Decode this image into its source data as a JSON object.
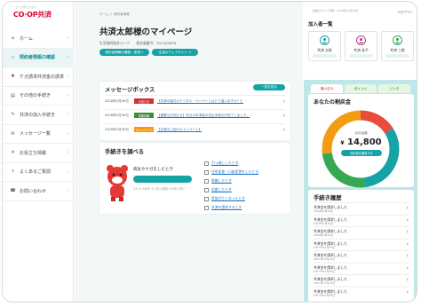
{
  "brand": {
    "logo_text": "CO·OP共済",
    "logo_sub": "コープきょうさい"
  },
  "nav": {
    "items": [
      {
        "label": "ホーム",
        "icon": "home-icon",
        "active": false
      },
      {
        "label": "契約者情報の確認",
        "icon": "id-card-icon",
        "active": true
      },
      {
        "label": "ケガ請求共済金の請求",
        "icon": "bandage-icon",
        "active": false
      },
      {
        "label": "その他の手続き",
        "icon": "document-icon",
        "active": false
      },
      {
        "label": "共済の加入手続き",
        "icon": "pen-icon",
        "active": false
      },
      {
        "label": "メッセージ一覧",
        "icon": "mail-icon",
        "active": false
      },
      {
        "label": "お役立ち情報",
        "icon": "lightbulb-icon",
        "active": false
      },
      {
        "label": "よくあるご質問",
        "icon": "question-icon",
        "active": false
      },
      {
        "label": "お問い合わせ",
        "icon": "phone-icon",
        "active": false
      }
    ]
  },
  "header": {
    "breadcrumb": "ホーム ＞ 契約者情報",
    "title": "共済太郎様のマイページ",
    "subline": "生活協同組合コープ　　組合員番号：912345678",
    "btn_contract": "契約者情報の確認・変更へ",
    "btn_web": "生協のウェブサイト ↗"
  },
  "messages": {
    "title": "メッセージボックス",
    "list_all": "一覧を見る",
    "rows": [
      {
        "date": "2018年1月30日",
        "badge": "お知らせ",
        "badge_color": "#d32f2f",
        "text": "【共済の給付のデジタル・ペーパーとはどう違いますか？】"
      },
      {
        "date": "2018年1月30日",
        "badge": "重要情報",
        "badge_color": "#3a8f3a",
        "text": "【重要なお知らせ】本日の共済金の支払手続きが完了しました。"
      },
      {
        "date": "2018年1月30日",
        "badge": "キャンペーン",
        "badge_color": "#f39c12",
        "text": "【共済のご紹介キャンペーン】"
      }
    ]
  },
  "procedures": {
    "title": "手続きを調べる",
    "question": "病気やケガをしたとき",
    "tags": "#ケガ #病気 #入院 #通院 #手術 #死亡",
    "links": [
      "引っ越ししたとき",
      "住所変更・口座変更をしたとき",
      "結婚したとき",
      "出産したとき",
      "家族が亡くなったとき",
      "共済を請求するとき"
    ]
  },
  "right": {
    "top_small": "最終ログイン日時：2018年01月30日",
    "logout": "ログアウト",
    "members_title": "加入者一覧",
    "members": [
      {
        "name": "共済 太郎",
        "color": "#16a3a5"
      },
      {
        "name": "共済 花子",
        "color": "#c23d8c"
      },
      {
        "name": "共済 三郎",
        "color": "#36a852"
      }
    ],
    "tabs": [
      "あいさつ",
      "ポイント",
      "リンク"
    ]
  },
  "points": {
    "title": "あなたの割戻金",
    "label": "合計金額",
    "currency": "¥",
    "value": "14,800",
    "button": "割戻金を確認する",
    "segments": [
      {
        "fraction": 0.16,
        "color": "#e74c3c"
      },
      {
        "fraction": 0.32,
        "color": "#16a3a5"
      },
      {
        "fraction": 0.25,
        "color": "#36a852"
      },
      {
        "fraction": 0.27,
        "color": "#f39c12"
      }
    ]
  },
  "history": {
    "title": "手続き履歴",
    "rows": [
      {
        "text": "共済金を請求しました",
        "date": "2018年1月28日"
      },
      {
        "text": "共済金を請求しました",
        "date": "2018年1月20日"
      },
      {
        "text": "共済金を請求しました",
        "date": "2018年1月10日"
      },
      {
        "text": "共済金を請求しました",
        "date": "2017年12月25日"
      },
      {
        "text": "共済金を請求しました",
        "date": "2017年12月10日"
      },
      {
        "text": "共済金を請求しました",
        "date": "2017年11月30日"
      },
      {
        "text": "共済金を請求しました",
        "date": "2017年11月12日"
      },
      {
        "text": "共済金を請求しました",
        "date": "2017年10月28日"
      }
    ]
  }
}
